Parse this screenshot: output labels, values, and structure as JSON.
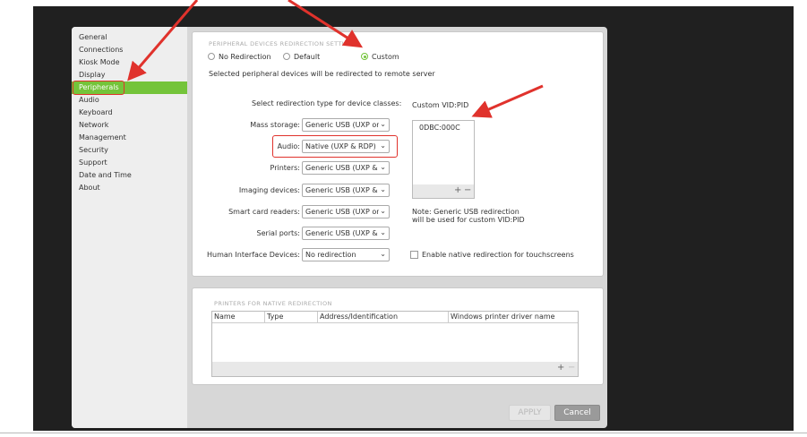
{
  "sidebar": {
    "items": [
      {
        "label": "General",
        "active": false
      },
      {
        "label": "Connections",
        "active": false
      },
      {
        "label": "Kiosk Mode",
        "active": false
      },
      {
        "label": "Display",
        "active": false
      },
      {
        "label": "Peripherals",
        "active": true
      },
      {
        "label": "Audio",
        "active": false
      },
      {
        "label": "Keyboard",
        "active": false
      },
      {
        "label": "Network",
        "active": false
      },
      {
        "label": "Management",
        "active": false
      },
      {
        "label": "Security",
        "active": false
      },
      {
        "label": "Support",
        "active": false
      },
      {
        "label": "Date and Time",
        "active": false
      },
      {
        "label": "About",
        "active": false
      }
    ]
  },
  "redirection": {
    "section_title": "PERIPHERAL DEVICES REDIRECTION SETTI",
    "options": [
      "No Redirection",
      "Default",
      "Custom"
    ],
    "selected": "Custom",
    "note": "Selected peripheral devices will be redirected to remote server",
    "select_heading": "Select redirection type for device classes:",
    "devices": [
      {
        "label": "Mass storage:",
        "value": "Generic USB (UXP only)"
      },
      {
        "label": "Audio:",
        "value": "Native (UXP & RDP)"
      },
      {
        "label": "Printers:",
        "value": "Generic USB (UXP & RDP)"
      },
      {
        "label": "Imaging devices:",
        "value": "Generic USB (UXP & RDP)"
      },
      {
        "label": "Smart card readers:",
        "value": "Generic USB (UXP only)"
      },
      {
        "label": "Serial ports:",
        "value": "Generic USB (UXP & RDP)"
      },
      {
        "label": "Human Interface Devices:",
        "value": "No redirection"
      }
    ],
    "vidpid_heading": "Custom  VID:PID",
    "vidpid_entries": [
      "0DBC:000C"
    ],
    "add_symbol": "+",
    "remove_symbol": "−",
    "vidpid_note_line1": "Note: Generic USB redirection",
    "vidpid_note_line2": "will be used for custom VID:PID",
    "touch_checkbox_label": "Enable native redirection for touchscreens",
    "touch_checked": false
  },
  "printers": {
    "section_title": "PRINTERS FOR NATIVE REDIRECTION",
    "columns": [
      "Name",
      "Type",
      "Address/Identification",
      "Windows printer driver name"
    ],
    "rows": [],
    "add_symbol": "+",
    "remove_symbol": "−"
  },
  "footer": {
    "apply_label": "APPLY",
    "cancel_label": "Cancel"
  },
  "colors": {
    "accent": "#74c43a",
    "annotation": "#e0322c",
    "backdrop": "#202020"
  }
}
